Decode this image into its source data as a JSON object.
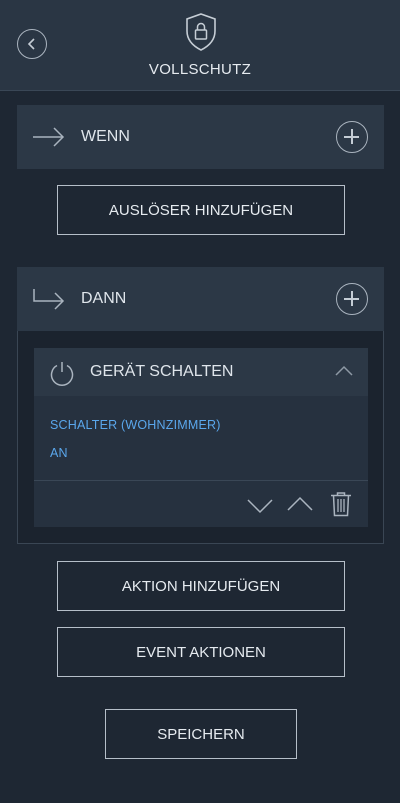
{
  "header": {
    "title": "VOLLSCHUTZ",
    "back_icon": "chevron-left-icon",
    "shield_icon": "shield-lock-icon"
  },
  "when_section": {
    "label": "WENN",
    "arrow_icon": "arrow-right-icon",
    "add_icon": "plus-circle-icon"
  },
  "add_trigger_label": "AUSLÖSER HINZUFÜGEN",
  "then_section": {
    "label": "DANN",
    "arrow_icon": "arrow-turn-right-icon",
    "add_icon": "plus-circle-icon"
  },
  "action_card": {
    "title": "GERÄT SCHALTEN",
    "icon": "power-icon",
    "device": "SCHALTER (WOHNZIMMER)",
    "state": "AN",
    "collapse_icon": "chevron-up-icon",
    "move_down_icon": "chevron-down-icon",
    "move_up_icon": "chevron-up-icon",
    "delete_icon": "trash-icon"
  },
  "add_action_label": "AKTION HINZUFÜGEN",
  "event_actions_label": "EVENT AKTIONEN",
  "save_label": "SPEICHERN",
  "colors": {
    "background": "#1e2733",
    "panel": "#2c3846",
    "accent_text": "#5aa7ec"
  }
}
